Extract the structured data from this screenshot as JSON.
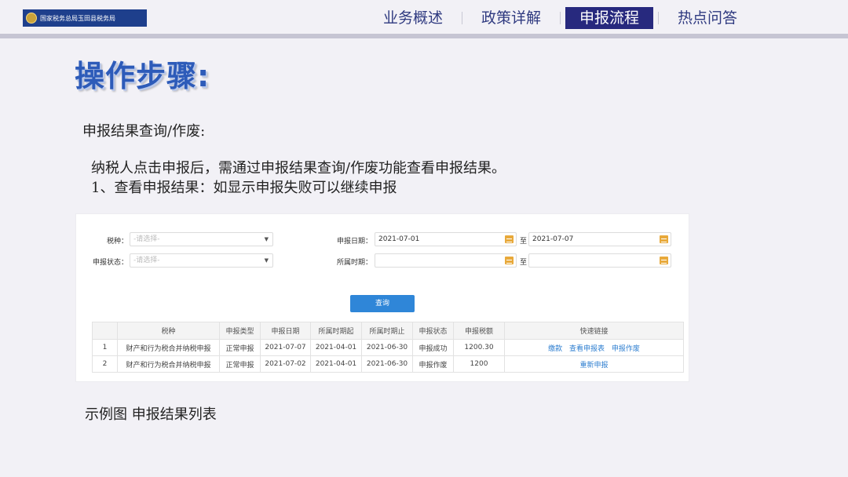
{
  "header": {
    "logo_text": "国家税务总局玉田县税务局",
    "nav": [
      {
        "label": "业务概述",
        "active": false
      },
      {
        "label": "政策详解",
        "active": false
      },
      {
        "label": "申报流程",
        "active": true
      },
      {
        "label": "热点问答",
        "active": false
      }
    ]
  },
  "content": {
    "heading": "操作步骤:",
    "subtitle": "申报结果查询/作废:",
    "para1": "纳税人点击申报后，需通过申报结果查询/作废功能查看申报结果。",
    "para2": "1、查看申报结果：如显示申报失败可以继续申报",
    "caption": "示例图  申报结果列表"
  },
  "screenshot": {
    "form": {
      "tax_type_label": "税种：",
      "tax_type_placeholder": "-请选择-",
      "status_label": "申报状态：",
      "status_placeholder": "-请选择-",
      "date_label": "申报日期：",
      "date_from": "2021-07-01",
      "to_label": "至",
      "date_to": "2021-07-07",
      "period_label": "所属时期：",
      "period_from": "",
      "period_to": "",
      "query_button": "查询"
    },
    "table": {
      "headers": [
        "",
        "税种",
        "申报类型",
        "申报日期",
        "所属时期起",
        "所属时期止",
        "申报状态",
        "申报税额",
        "快速链接"
      ],
      "rows": [
        {
          "no": "1",
          "tax": "财产和行为税合并纳税申报",
          "type": "正常申报",
          "date": "2021-07-07",
          "start": "2021-04-01",
          "end": "2021-06-30",
          "status": "申报成功",
          "amount": "1200.30",
          "links": [
            "缴款",
            "查看申报表",
            "申报作废"
          ]
        },
        {
          "no": "2",
          "tax": "财产和行为税合并纳税申报",
          "type": "正常申报",
          "date": "2021-07-02",
          "start": "2021-04-01",
          "end": "2021-06-30",
          "status": "申报作废",
          "amount": "1200",
          "links": [
            "重新申报"
          ]
        }
      ]
    }
  }
}
